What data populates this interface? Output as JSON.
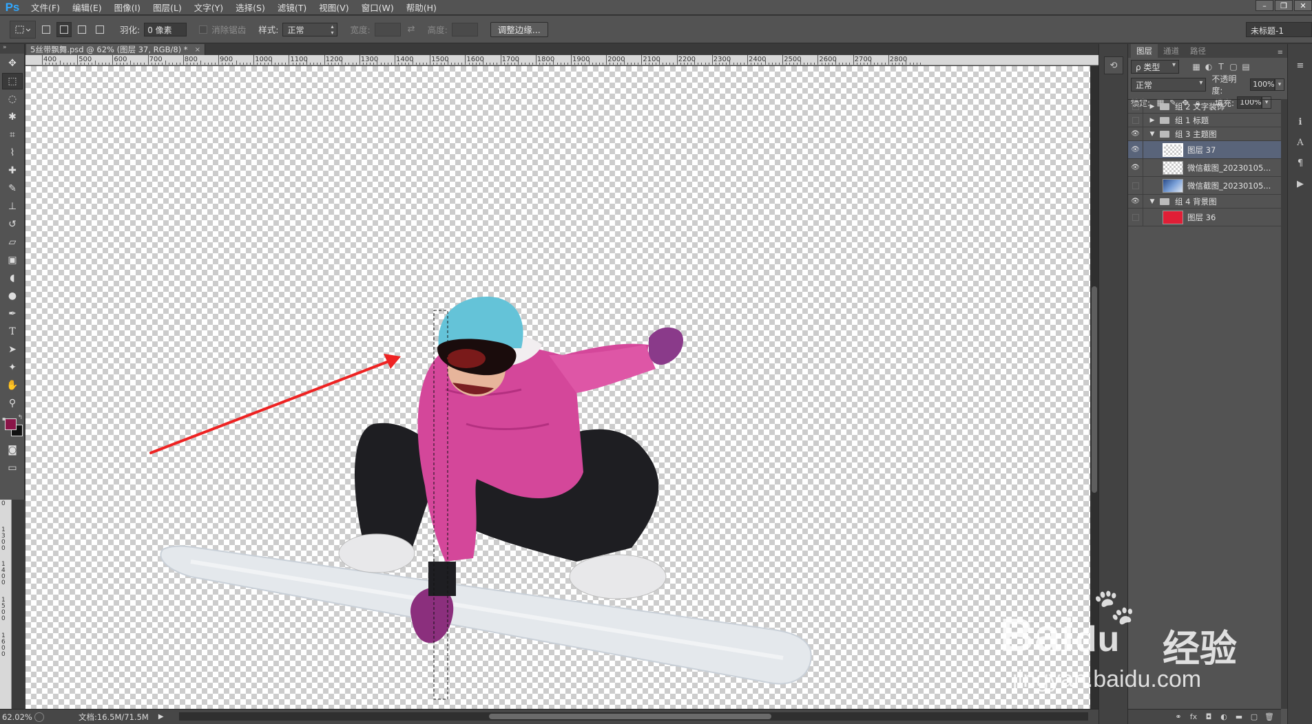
{
  "app": {
    "logo": "Ps"
  },
  "menu": [
    "文件(F)",
    "编辑(E)",
    "图像(I)",
    "图层(L)",
    "文字(Y)",
    "选择(S)",
    "滤镜(T)",
    "视图(V)",
    "窗口(W)",
    "帮助(H)"
  ],
  "window_controls": {
    "minimize": "–",
    "restore": "❐",
    "close": "✕"
  },
  "options": {
    "feather_label": "羽化:",
    "feather_value": "0 像素",
    "antialias_label": "消除锯齿",
    "style_label": "样式:",
    "style_value": "正常",
    "width_label": "宽度:",
    "height_label": "高度:",
    "refine_edge_button": "调整边缘...",
    "workspace": "未标题-1"
  },
  "document": {
    "tab_title": "5丝带飘舞.psd @ 62% (图层 37, RGB/8) *",
    "close": "×"
  },
  "ruler": {
    "top_labels": [
      "400",
      "500",
      "600",
      "700",
      "800",
      "900",
      "1000",
      "1100",
      "1200",
      "1300",
      "1400",
      "1500",
      "1600",
      "1700",
      "1800",
      "1900",
      "2000",
      "2100",
      "2200",
      "2300",
      "2400",
      "2500",
      "2600",
      "2700",
      "2800"
    ],
    "left_labels": [
      "0",
      "1300",
      "1400",
      "1500",
      "1600"
    ]
  },
  "status": {
    "zoom": "62.02%",
    "doc_info": "文档:16.5M/71.5M"
  },
  "layers_panel": {
    "tabs": [
      "图层",
      "通道",
      "路径"
    ],
    "filter_label": "ρ 类型",
    "blend_mode": "正常",
    "opacity_label": "不透明度:",
    "opacity_value": "100%",
    "lock_label": "锁定:",
    "fill_label": "填充:",
    "fill_value": "100%",
    "layers": [
      {
        "name": "组 2 文字装饰",
        "kind": "group",
        "visible": false,
        "expanded": false
      },
      {
        "name": "组 1 标题",
        "kind": "group",
        "visible": false,
        "expanded": false
      },
      {
        "name": "组 3 主题图",
        "kind": "group",
        "visible": true,
        "expanded": true
      },
      {
        "name": "图层 37",
        "kind": "layer",
        "visible": true,
        "selected": true,
        "thumb": "transparent"
      },
      {
        "name": "微信截图_20230105...",
        "kind": "layer",
        "visible": true,
        "thumb": "transparent"
      },
      {
        "name": "微信截图_20230105...",
        "kind": "layer",
        "visible": false,
        "thumb": "photo"
      },
      {
        "name": "组 4 背景图",
        "kind": "group",
        "visible": true,
        "expanded": true
      },
      {
        "name": "图层 36",
        "kind": "layer",
        "visible": false,
        "thumb": "red"
      }
    ]
  },
  "colors": {
    "foreground": "#8a1548",
    "background": "#111111",
    "annotation_arrow": "#ee2222",
    "selection_highlight": "#59647a",
    "layer36_fill": "#e01e36"
  },
  "watermark": {
    "brand": "Bai",
    "brand_suffix": "du",
    "subtitle": "经验",
    "url": "jingyan.baidu.com"
  }
}
